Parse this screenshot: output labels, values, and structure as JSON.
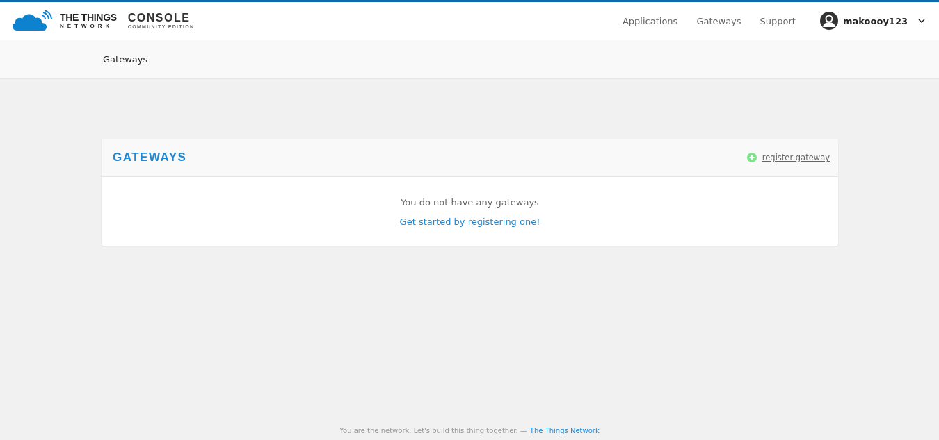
{
  "logo": {
    "brand_line_1": "THE THINGS",
    "brand_line_2": "NETWORK",
    "product": "CONSOLE",
    "edition": "COMMUNITY EDITION"
  },
  "nav": [
    {
      "label": "Applications"
    },
    {
      "label": "Gateways"
    },
    {
      "label": "Support"
    }
  ],
  "user": {
    "name": "makoooy123"
  },
  "breadcrumb": "Gateways",
  "card": {
    "title": "GATEWAYS",
    "action": "register gateway",
    "empty_message": "You do not have any gateways",
    "empty_link": "Get started by registering one!"
  },
  "footer": {
    "text": "You are the network. Let's build this thing together. —",
    "link": "The Things Network"
  }
}
